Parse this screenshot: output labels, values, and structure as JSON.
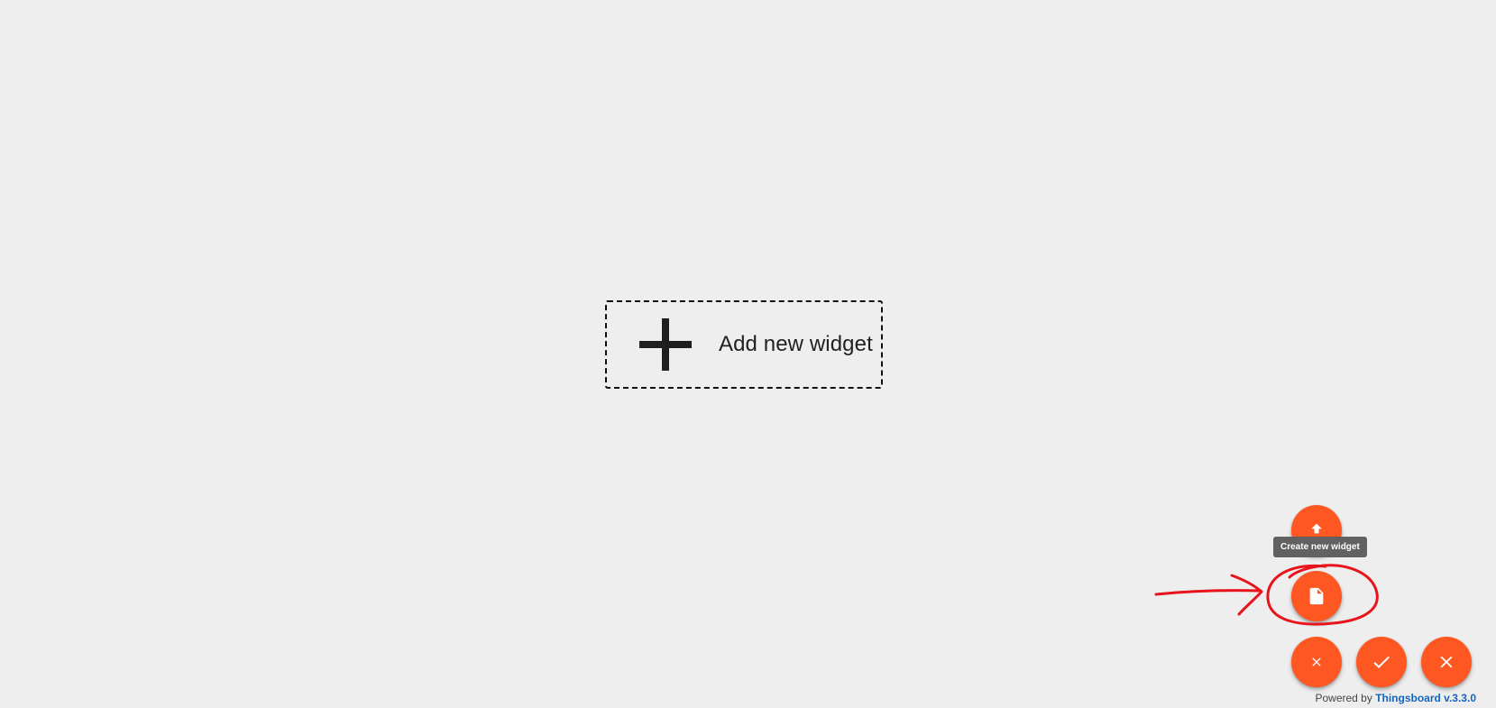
{
  "dashboard": {
    "add_widget_label": "Add new widget"
  },
  "fab_menu": {
    "import_label": "Import widget",
    "create_tooltip": "Create new widget",
    "close_menu_label": "Close",
    "apply_label": "Apply changes",
    "cancel_label": "Cancel"
  },
  "footer": {
    "powered_by": "Powered by",
    "product": "Thingsboard v.3.3.0"
  },
  "colors": {
    "fab": "#ff5722",
    "background": "#eeeeee",
    "annotation": "#e8141c",
    "link": "#1565c0"
  },
  "icons": {
    "import": "upload-icon",
    "create": "file-icon",
    "close_menu": "close-icon",
    "apply": "check-icon",
    "cancel": "close-icon"
  }
}
